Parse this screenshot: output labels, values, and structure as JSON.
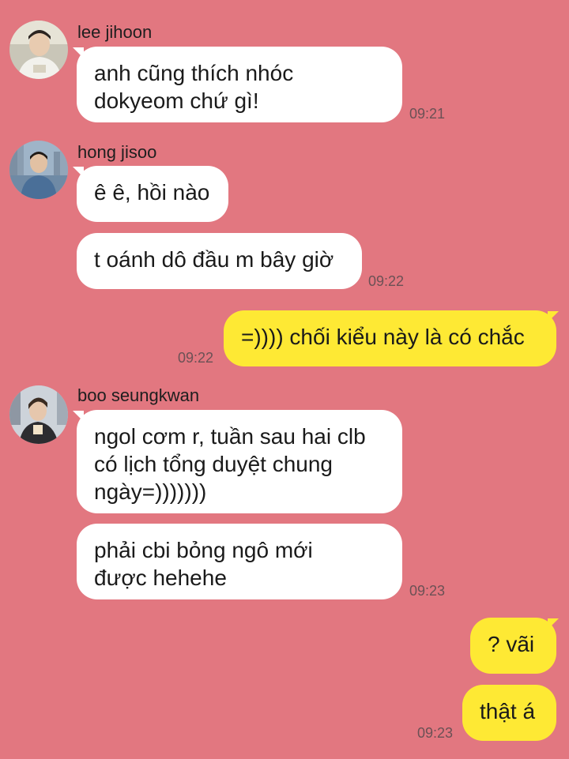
{
  "messages_group_1": {
    "sender": "lee jihoon",
    "avatar": "avatar-lee-jihoon",
    "bubbles": [
      {
        "lines": [
          "anh cũng thích nhóc",
          "dokyeom chứ gì!"
        ]
      }
    ],
    "time": "09:21"
  },
  "messages_group_2": {
    "sender": "hong jisoo",
    "avatar": "avatar-hong-jisoo",
    "bubbles": [
      {
        "lines": [
          "ê ê, hồi nào"
        ]
      },
      {
        "lines": [
          "t oánh dô đầu m bây giờ"
        ]
      }
    ],
    "time": "09:22"
  },
  "outgoing_1": {
    "bubbles": [
      {
        "lines": [
          "=)))) chối kiểu này là có chắc"
        ]
      }
    ],
    "time": "09:22"
  },
  "messages_group_3": {
    "sender": "boo seungkwan",
    "avatar": "avatar-boo-seungkwan",
    "bubbles": [
      {
        "lines": [
          "ngol cơm r, tuần sau hai clb",
          "có lịch tổng duyệt chung",
          "ngày=)))))))"
        ]
      },
      {
        "lines": [
          "phải cbi bỏng ngô mới",
          "được hehehe"
        ]
      }
    ],
    "time": "09:23"
  },
  "outgoing_2": {
    "bubbles": [
      {
        "lines": [
          "? vãi"
        ]
      },
      {
        "lines": [
          "thật á"
        ]
      }
    ],
    "time": "09:23"
  },
  "colors": {
    "background": "#e27780",
    "incoming_bubble": "#ffffff",
    "outgoing_bubble": "#fee934"
  }
}
